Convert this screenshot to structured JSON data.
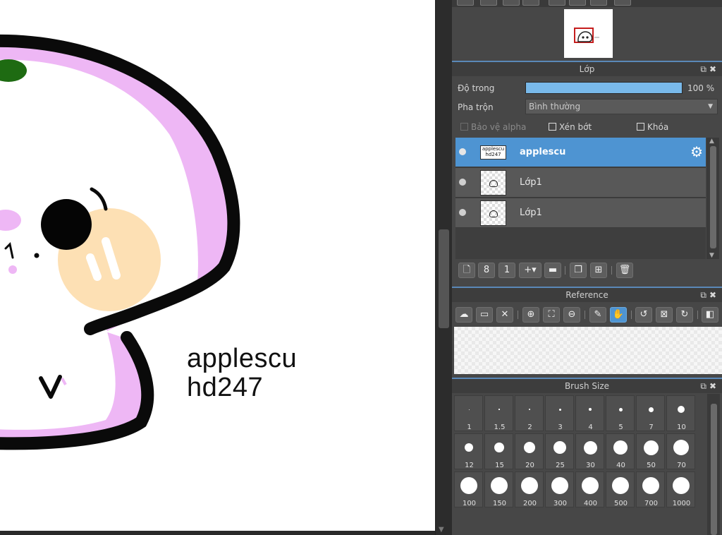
{
  "canvas": {
    "text_line1": "applescu",
    "text_line2": "hd247"
  },
  "colors": {
    "accent": "#4e94d2",
    "panel_bg": "#474747",
    "pink": "#eeb7f5",
    "peach": "#fde0b4",
    "green": "#1e6b12"
  },
  "layer_panel": {
    "title": "Lớp",
    "opacity_label": "Độ trong",
    "opacity_value": "100 %",
    "opacity_fraction": 1.0,
    "blend_label": "Pha trộn",
    "blend_value": "Bình thường",
    "protect_alpha": "Bảo vệ alpha",
    "clipping": "Xén bớt",
    "lock": "Khóa",
    "layers": [
      {
        "name": "applescu",
        "thumb_text": "applescu hd247",
        "selected": true
      },
      {
        "name": "Lớp1",
        "selected": false
      },
      {
        "name": "Lớp1",
        "selected": false
      }
    ]
  },
  "reference_panel": {
    "title": "Reference"
  },
  "brush_panel": {
    "title": "Brush Size",
    "sizes": [
      "1",
      "1.5",
      "2",
      "3",
      "4",
      "5",
      "7",
      "10",
      "12",
      "15",
      "20",
      "25",
      "30",
      "40",
      "50",
      "70",
      "100",
      "150",
      "200",
      "300",
      "400",
      "500",
      "700",
      "1000"
    ]
  },
  "icons": {
    "panel_header": [
      "float-icon",
      "close-icon"
    ],
    "layer_toolbar": [
      "new-layer-icon",
      "new-8bit-layer-icon",
      "new-1bit-layer-icon",
      "add-layer-menu-icon",
      "folder-icon",
      "duplicate-icon",
      "merge-icon",
      "delete-icon"
    ],
    "reference_toolbar": [
      "open-cloud-icon",
      "open-folder-icon",
      "close-icon",
      "zoom-in-icon",
      "fit-icon",
      "zoom-out-icon",
      "eyedropper-icon",
      "hand-icon",
      "rotate-left-icon",
      "fit-screen-icon",
      "rotate-right-icon",
      "flip-icon"
    ]
  }
}
